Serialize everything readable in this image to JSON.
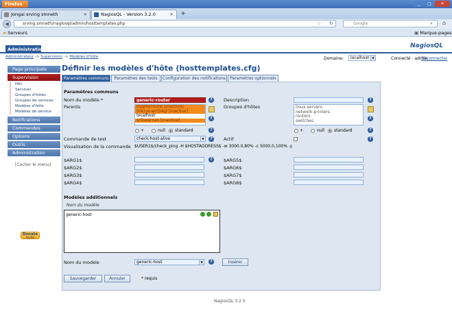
{
  "browser": {
    "menu_button": "Firefox",
    "tabs": [
      {
        "label": "Jongai srving smneth"
      },
      {
        "label": "NagiosQL - Version 3.2.0"
      }
    ],
    "new_tab": "+",
    "url": "srving.smneth/nagiosql/admin/hosttemplates.php",
    "search_placeholder": "Google",
    "bookmark_left": "Serveurs",
    "bookmark_right": "Marque-pages"
  },
  "header": {
    "admin_tab": "Administration",
    "logo": "NagiosQL"
  },
  "breadcrumb": {
    "items": [
      "Administrateur",
      "Supervision",
      "Modèles d'hôte"
    ],
    "sep": "->",
    "domain_label": "Domaine:",
    "domain_value": "localhost",
    "connected_label": "Connecté : admin",
    "logout": "Déconnecter"
  },
  "sidebar": {
    "sections": [
      "Page principale",
      "Supervision",
      "Notifications",
      "Commandes",
      "Options",
      "Outils",
      "Administration"
    ],
    "items": [
      "Hôt",
      "Services",
      "Groupes d'hôtes",
      "Groupes de services",
      "Modèles d'hôte",
      "Modèles de service"
    ],
    "hide_menu": "[Cacher le menu]",
    "donate": "Donate",
    "donate_sub": "PayPal"
  },
  "main": {
    "title": "Définir les modèles d'hôte (hosttemplates.cfg)",
    "tabs": [
      "Paramètres communs",
      "Paramètres des tests",
      "Configuration des notifications",
      "Paramètres optionnels"
    ],
    "section_common": "Paramètres communs",
    "template_name_label": "Nom du modèle *",
    "template_name_value": "generic-router",
    "description_label": "Description",
    "parents_label": "Parents",
    "parents_options": [
      "lhj@ferrouho [inactive]",
      "linkrys-wrt54gl [inactive]",
      "localhost",
      "srltvesrnas [inactive]"
    ],
    "hostgroups_label": "Groupes d'hôtes",
    "hostgroups_options": [
      "linux-servers",
      "network-printers",
      "routers",
      "switches"
    ],
    "null_label": "null",
    "standard_label": "standard",
    "plus_label": "+",
    "check_command_label": "Commande de test",
    "check_command_value": "check-host-alive",
    "active_label": "Actif",
    "command_view_label": "Visualisation de la commande",
    "command_view_value": "$USER1$/check_ping -H $HOSTADDRESS$ -w 3000.0,80% -c 5000.0,100% -p 1",
    "args_left": [
      "$ARG1$",
      "$ARG2$",
      "$ARG3$",
      "$ARG4$"
    ],
    "args_right": [
      "$ARG5$",
      "$ARG6$",
      "$ARG7$",
      "$ARG8$"
    ],
    "additional_title": "Modèles additionnels",
    "additional_col": "Nom du modèle",
    "additional_entry": "generic-host",
    "add_template_label": "Nom du modèle",
    "add_template_value": "generic-host",
    "insert_button": "Insérer",
    "save_button": "Sauvegarder",
    "cancel_button": "Annuler",
    "required_note": "* requis"
  },
  "footer": "NagiosQL 3.2.0",
  "colors": {
    "accent": "#2a5b9a",
    "selected": "#b51b1b",
    "highlight": "#f28a1c"
  }
}
